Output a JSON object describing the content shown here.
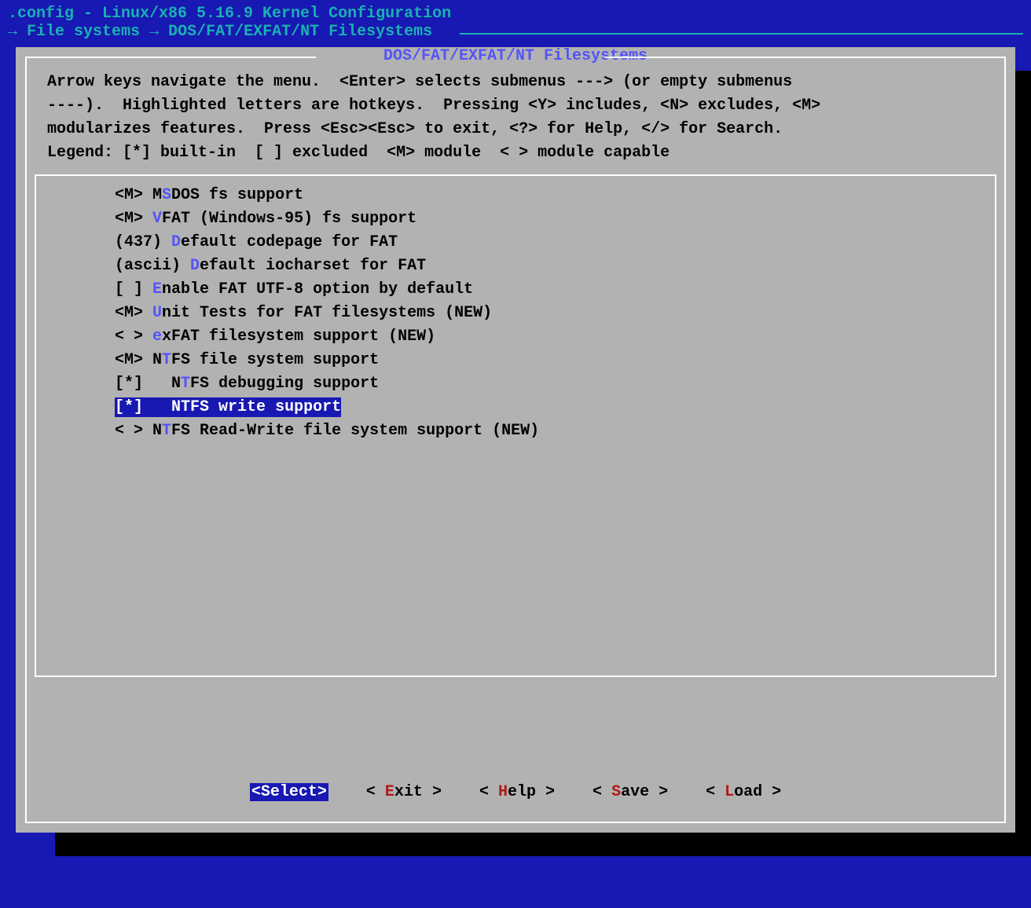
{
  "header": {
    "title": ".config - Linux/x86 5.16.9 Kernel Configuration"
  },
  "breadcrumb": {
    "arrow1": "→",
    "item1": "File systems",
    "arrow2": "→",
    "item2": "DOS/FAT/EXFAT/NT Filesystems"
  },
  "panel": {
    "title": " DOS/FAT/EXFAT/NT Filesystems "
  },
  "help": "Arrow keys navigate the menu.  <Enter> selects submenus ---> (or empty submenus\n----).  Highlighted letters are hotkeys.  Pressing <Y> includes, <N> excludes, <M>\nmodularizes features.  Press <Esc><Esc> to exit, <?> for Help, </> for Search.\nLegend: [*] built-in  [ ] excluded  <M> module  < > module capable",
  "menu": [
    {
      "mark": "<M>",
      "pre": " M",
      "hot": "S",
      "post": "DOS fs support",
      "indent": ""
    },
    {
      "mark": "<M>",
      "pre": " ",
      "hot": "V",
      "post": "FAT (Windows-95) fs support",
      "indent": ""
    },
    {
      "mark": "(437)",
      "pre": " ",
      "hot": "D",
      "post": "efault codepage for FAT",
      "indent": ""
    },
    {
      "mark": "(ascii)",
      "pre": " ",
      "hot": "D",
      "post": "efault iocharset for FAT",
      "indent": ""
    },
    {
      "mark": "[ ]",
      "pre": " ",
      "hot": "E",
      "post": "nable FAT UTF-8 option by default",
      "indent": ""
    },
    {
      "mark": "<M>",
      "pre": " ",
      "hot": "U",
      "post": "nit Tests for FAT filesystems (NEW)",
      "indent": ""
    },
    {
      "mark": "< >",
      "pre": " ",
      "hot": "e",
      "post": "xFAT filesystem support (NEW)",
      "indent": ""
    },
    {
      "mark": "<M>",
      "pre": " N",
      "hot": "T",
      "post": "FS file system support",
      "indent": ""
    },
    {
      "mark": "[*]",
      "pre": "   N",
      "hot": "T",
      "post": "FS debugging support",
      "indent": ""
    },
    {
      "mark": "[*]",
      "pre": "   N",
      "hot": "T",
      "post": "FS write support",
      "indent": "",
      "selected": true
    },
    {
      "mark": "< >",
      "pre": " N",
      "hot": "T",
      "post": "FS Read-Write file system support (NEW)",
      "indent": ""
    }
  ],
  "buttons": {
    "select": {
      "open": "<",
      "hot": "S",
      "rest": "elect",
      "close": ">"
    },
    "exit": {
      "open": "< ",
      "hot": "E",
      "rest": "xit ",
      "close": ">"
    },
    "help": {
      "open": "< ",
      "hot": "H",
      "rest": "elp ",
      "close": ">"
    },
    "save": {
      "open": "< ",
      "hot": "S",
      "rest": "ave ",
      "close": ">"
    },
    "load": {
      "open": "< ",
      "hot": "L",
      "rest": "oad ",
      "close": ">"
    }
  }
}
